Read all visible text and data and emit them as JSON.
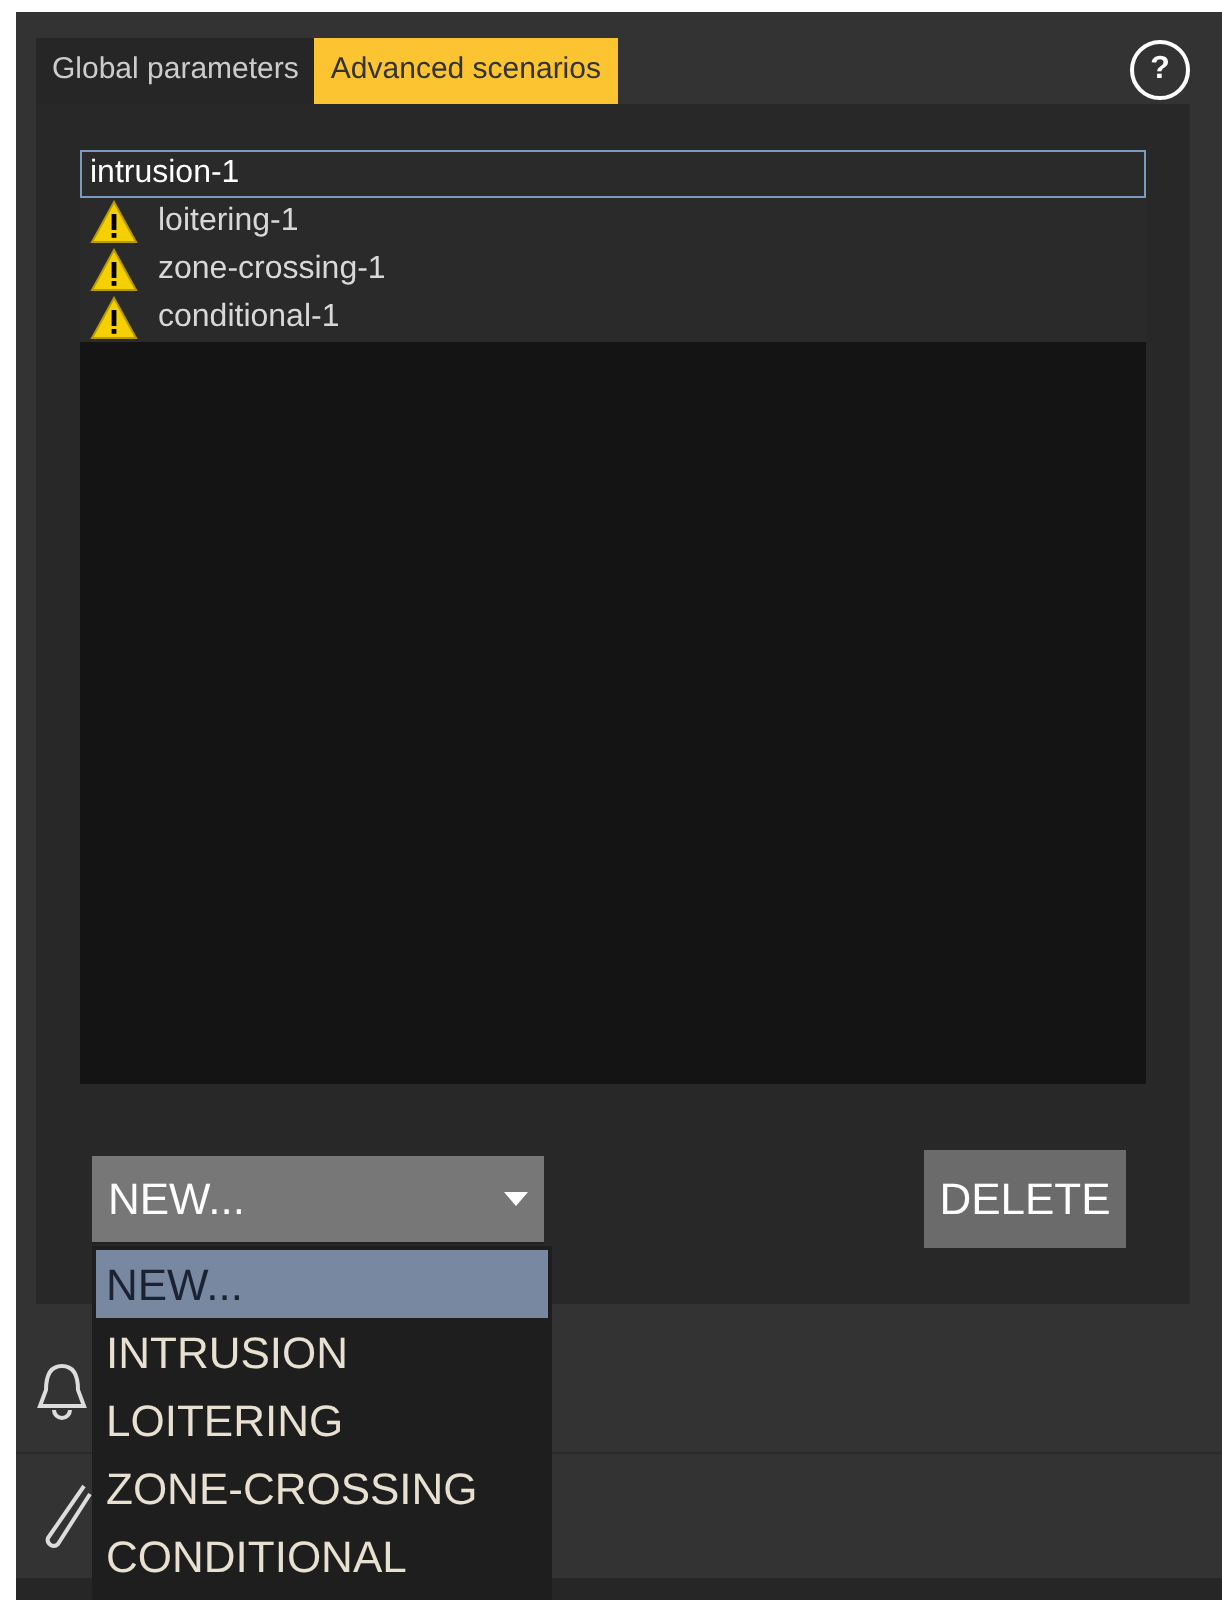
{
  "tabs": [
    {
      "label": "Global parameters",
      "selected": false
    },
    {
      "label": "Advanced scenarios",
      "selected": true
    }
  ],
  "help": {
    "label": "?"
  },
  "scenarios": [
    {
      "name": "intrusion-1",
      "warning": false,
      "selected": true
    },
    {
      "name": "loitering-1",
      "warning": true,
      "selected": false
    },
    {
      "name": "zone-crossing-1",
      "warning": true,
      "selected": false
    },
    {
      "name": "conditional-1",
      "warning": true,
      "selected": false
    }
  ],
  "new_dropdown": {
    "value": "NEW...",
    "expanded": true,
    "options": [
      {
        "label": "NEW...",
        "selected": true
      },
      {
        "label": "INTRUSION",
        "selected": false
      },
      {
        "label": "LOITERING",
        "selected": false
      },
      {
        "label": "ZONE-CROSSING",
        "selected": false
      },
      {
        "label": "CONDITIONAL",
        "selected": false
      }
    ]
  },
  "delete_button": {
    "label": "DELETE"
  }
}
